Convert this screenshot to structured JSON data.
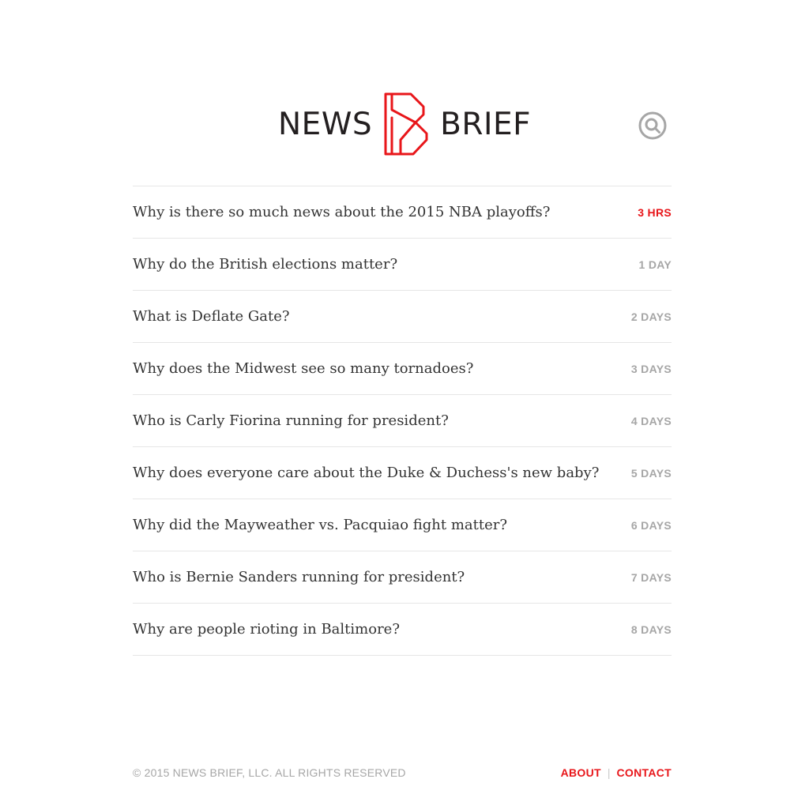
{
  "header": {
    "logo_left": "NEWS",
    "logo_right": "BRIEF"
  },
  "colors": {
    "brand": "#e8161a",
    "text": "#333333",
    "muted": "#a6a6a6"
  },
  "icons": {
    "search": "search-icon",
    "logo_mark": "b-logo-icon"
  },
  "articles": [
    {
      "title": "Why is there so much news about the 2015 NBA playoffs?",
      "time": "3 HRS",
      "recent": true
    },
    {
      "title": "Why do the British elections matter?",
      "time": "1 DAY",
      "recent": false
    },
    {
      "title": "What is Deflate Gate?",
      "time": "2 DAYS",
      "recent": false
    },
    {
      "title": "Why does the Midwest see so many tornadoes?",
      "time": "3 DAYS",
      "recent": false
    },
    {
      "title": "Who is Carly Fiorina running for president?",
      "time": "4 DAYS",
      "recent": false
    },
    {
      "title": "Why does everyone care about the Duke & Duchess's new baby?",
      "time": "5 DAYS",
      "recent": false
    },
    {
      "title": "Why did the Mayweather vs. Pacquiao fight matter?",
      "time": "6 DAYS",
      "recent": false
    },
    {
      "title": "Who is Bernie Sanders running for president?",
      "time": "7 DAYS",
      "recent": false
    },
    {
      "title": "Why are people rioting in Baltimore?",
      "time": "8 DAYS",
      "recent": false
    }
  ],
  "footer": {
    "copyright": "© 2015 NEWS BRIEF, LLC. ALL RIGHTS RESERVED",
    "separator": "|",
    "about_label": "ABOUT",
    "contact_label": "CONTACT"
  }
}
